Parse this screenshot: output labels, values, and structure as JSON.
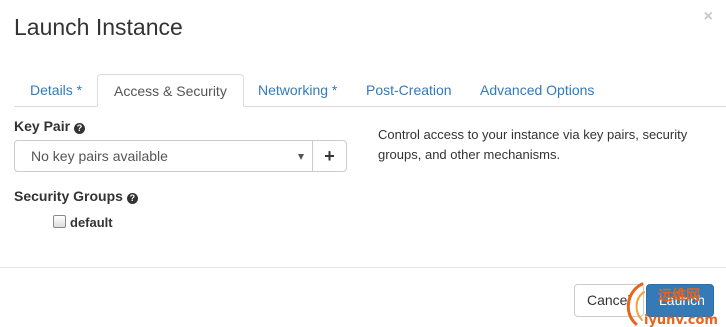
{
  "modal": {
    "title": "Launch Instance",
    "close_label": "×"
  },
  "tabs": [
    {
      "label": "Details *",
      "active": false
    },
    {
      "label": "Access & Security",
      "active": true
    },
    {
      "label": "Networking *",
      "active": false
    },
    {
      "label": "Post-Creation",
      "active": false
    },
    {
      "label": "Advanced Options",
      "active": false
    }
  ],
  "key_pair": {
    "label": "Key Pair",
    "help_icon": "question-circle-icon",
    "selected": "No key pairs available",
    "add_label": "+"
  },
  "security_groups": {
    "label": "Security Groups",
    "help_icon": "question-circle-icon",
    "items": [
      {
        "label": "default",
        "checked": false
      }
    ]
  },
  "help_text": "Control access to your instance via key pairs, security groups, and other mechanisms.",
  "footer": {
    "cancel_label": "Cancel",
    "launch_label": "Launch"
  },
  "watermark": {
    "cn_text": "运维网",
    "url_text": "iyunv.com"
  },
  "colors": {
    "link": "#337ab7",
    "primary": "#337ab7",
    "border": "#dddddd",
    "watermark_orange": "#e8641b"
  }
}
